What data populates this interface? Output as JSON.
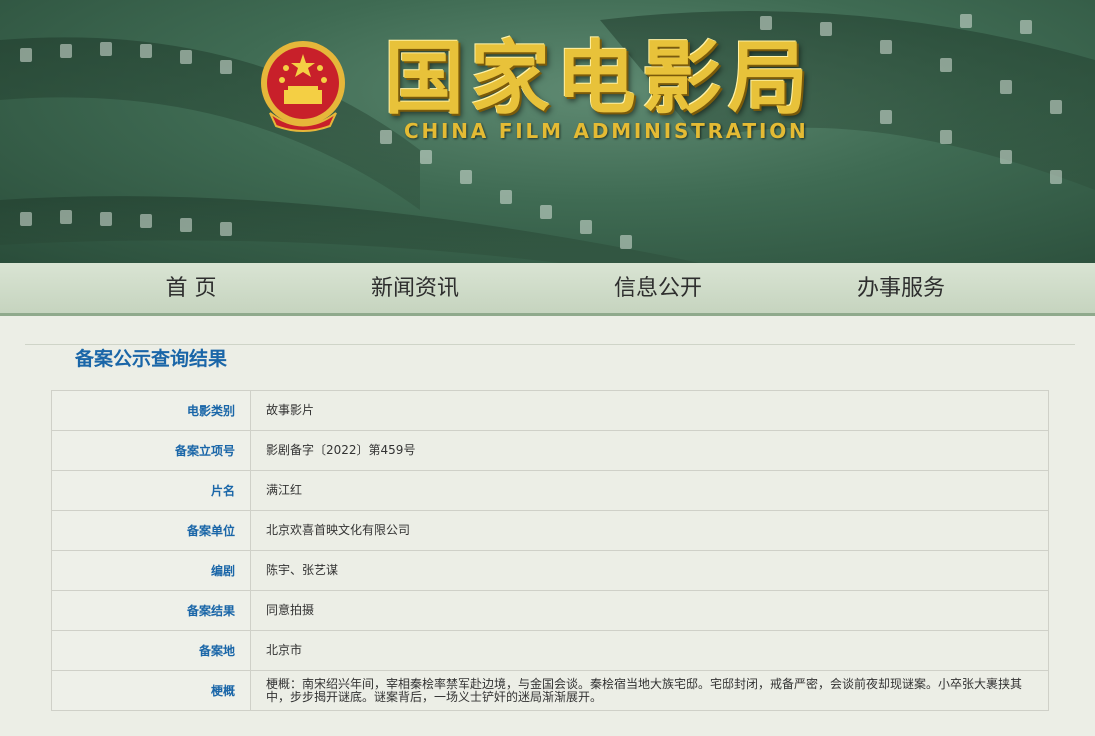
{
  "header": {
    "title_cn": "国家电影局",
    "title_en": "CHINA FILM ADMINISTRATION",
    "emblem_icon": "national-emblem-icon"
  },
  "nav": {
    "items": [
      {
        "label": "首 页"
      },
      {
        "label": "新闻资讯"
      },
      {
        "label": "信息公开"
      },
      {
        "label": "办事服务"
      }
    ]
  },
  "main": {
    "heading": "备案公示查询结果",
    "rows": [
      {
        "label": "电影类别",
        "value": "故事影片"
      },
      {
        "label": "备案立项号",
        "value": "影剧备字〔2022〕第459号"
      },
      {
        "label": "片名",
        "value": "满江红"
      },
      {
        "label": "备案单位",
        "value": "北京欢喜首映文化有限公司"
      },
      {
        "label": "编剧",
        "value": "陈宇、张艺谋"
      },
      {
        "label": "备案结果",
        "value": "同意拍摄"
      },
      {
        "label": "备案地",
        "value": "北京市"
      },
      {
        "label": "梗概",
        "value": "梗概：南宋绍兴年间，宰相秦桧率禁军赴边境，与金国会谈。秦桧宿当地大族宅邸。宅邸封闭，戒备严密，会谈前夜却现谜案。小卒张大裹挟其中，步步揭开谜底。谜案背后，一场义士铲奸的迷局渐渐展开。"
      }
    ]
  },
  "colors": {
    "accent_blue": "#1a66a8",
    "banner_green": "#3f6b53",
    "title_gold": "#e8c23a"
  }
}
